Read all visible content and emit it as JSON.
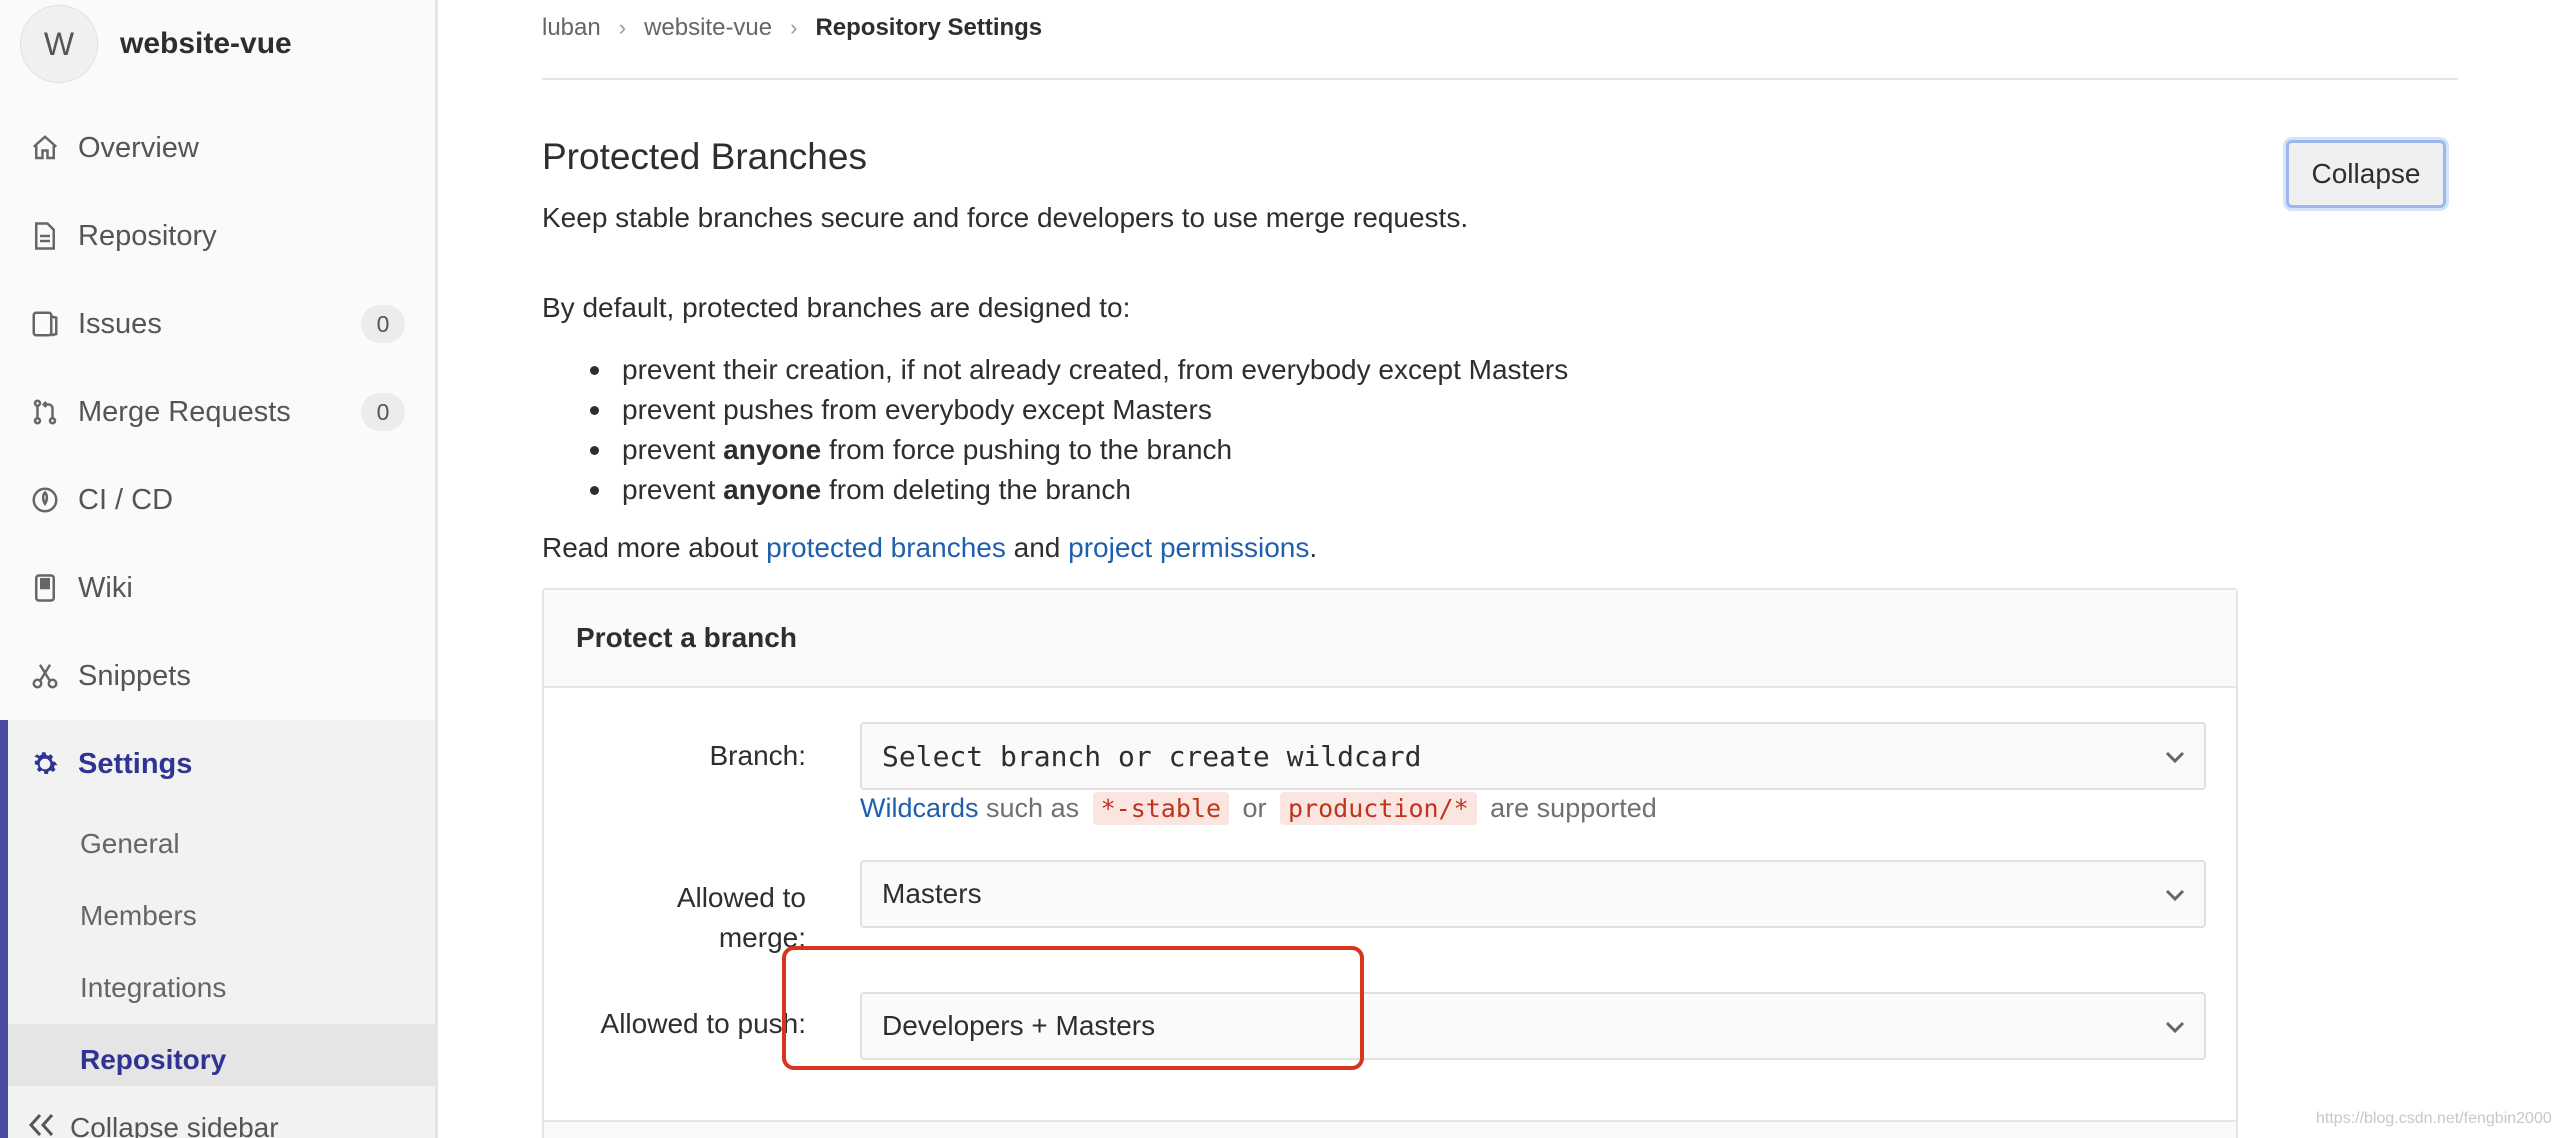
{
  "sidebar": {
    "avatar_letter": "W",
    "project_name": "website-vue",
    "items": [
      {
        "label": "Overview",
        "icon": "home-icon"
      },
      {
        "label": "Repository",
        "icon": "document-icon"
      },
      {
        "label": "Issues",
        "icon": "issues-icon",
        "badge": "0"
      },
      {
        "label": "Merge Requests",
        "icon": "merge-request-icon",
        "badge": "0"
      },
      {
        "label": "CI / CD",
        "icon": "rocket-icon"
      },
      {
        "label": "Wiki",
        "icon": "book-icon"
      },
      {
        "label": "Snippets",
        "icon": "scissors-icon"
      },
      {
        "label": "Settings",
        "icon": "gear-icon"
      }
    ],
    "settings_sub": [
      "General",
      "Members",
      "Integrations",
      "Repository"
    ],
    "collapse_label": "Collapse sidebar"
  },
  "breadcrumb": {
    "owner": "luban",
    "project": "website-vue",
    "current": "Repository Settings"
  },
  "section": {
    "title": "Protected Branches",
    "description": "Keep stable branches secure and force developers to use merge requests.",
    "collapse_button": "Collapse",
    "intro": "By default, protected branches are designed to:",
    "bullets": [
      {
        "pre": "prevent their creation, if not already created, from everybody except Masters",
        "bold": "",
        "post": ""
      },
      {
        "pre": "prevent pushes from everybody except Masters",
        "bold": "",
        "post": ""
      },
      {
        "pre": "prevent ",
        "bold": "anyone",
        "post": " from force pushing to the branch"
      },
      {
        "pre": "prevent ",
        "bold": "anyone",
        "post": " from deleting the branch"
      }
    ],
    "readmore_pre": "Read more about ",
    "readmore_link1": "protected branches",
    "readmore_mid": " and ",
    "readmore_link2": "project permissions",
    "readmore_post": "."
  },
  "form": {
    "card_title": "Protect a branch",
    "branch_label": "Branch:",
    "branch_value": "Select branch or create wildcard",
    "hint_link": "Wildcards",
    "hint_mid1": " such as ",
    "hint_code1": "*-stable",
    "hint_mid2": " or ",
    "hint_code2": "production/*",
    "hint_post": " are supported",
    "merge_label_1": "Allowed to",
    "merge_label_2": "merge:",
    "merge_value": "Masters",
    "push_label": "Allowed to push:",
    "push_value": "Developers + Masters"
  },
  "watermark": "https://blog.csdn.net/fengbin2000",
  "colors": {
    "accent": "#2f3391",
    "link": "#1f5fad",
    "highlight": "#d7351c",
    "code_bg": "#fbe5e1",
    "code_fg": "#c0341d"
  }
}
